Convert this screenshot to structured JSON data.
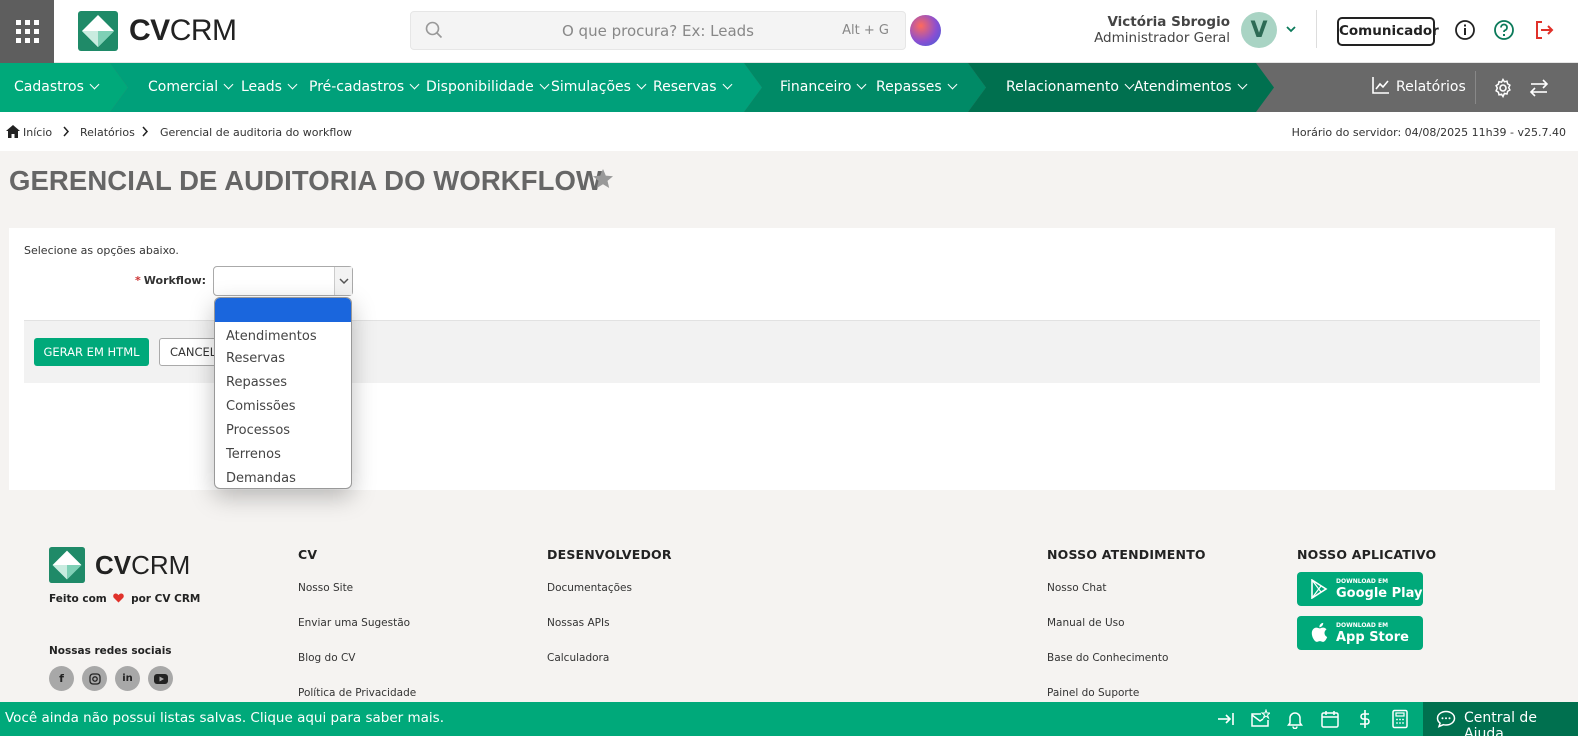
{
  "header": {
    "logo_text_bold": "CV",
    "logo_text_light": "CRM",
    "search_placeholder": "O que procura? Ex: Leads",
    "search_shortcut": "Alt + G",
    "user_name": "Victória Sbrogio",
    "user_role": "Administrador Geral",
    "avatar_letter": "V",
    "communicator_label": "Comunicador"
  },
  "nav": {
    "items": [
      {
        "label": "Cadastros"
      },
      {
        "label": "Comercial"
      },
      {
        "label": "Leads"
      },
      {
        "label": "Pré-cadastros"
      },
      {
        "label": "Disponibilidade"
      },
      {
        "label": "Simulações"
      },
      {
        "label": "Reservas"
      },
      {
        "label": "Financeiro"
      },
      {
        "label": "Repasses"
      },
      {
        "label": "Relacionamento"
      },
      {
        "label": "Atendimentos"
      }
    ],
    "reports_label": "Relatórios"
  },
  "breadcrumb": {
    "home": "Início",
    "reports": "Relatórios",
    "current": "Gerencial de auditoria do workflow",
    "server_time": "Horário do servidor: 04/08/2025 11h39 - v25.7.40"
  },
  "page": {
    "title": "GERENCIAL DE AUDITORIA DO WORKFLOW",
    "intro": "Selecione as opções abaixo.",
    "required_mark": "*",
    "workflow_label": "Workflow:",
    "generate_label": "GERAR EM HTML",
    "cancel_label": "CANCELAR"
  },
  "dropdown": {
    "options": [
      "",
      "Atendimentos",
      "Reservas",
      "Repasses",
      "Comissões",
      "Processos",
      "Terrenos",
      "Demandas"
    ],
    "highlighted_index": 0
  },
  "footer": {
    "made_with": "Feito com",
    "made_by": "por CV CRM",
    "social_title": "Nossas redes sociais",
    "columns": [
      {
        "title": "CV",
        "links": [
          "Nosso Site",
          "Enviar uma Sugestão",
          "Blog do CV",
          "Política de Privacidade"
        ]
      },
      {
        "title": "DESENVOLVEDOR",
        "links": [
          "Documentações",
          "Nossas APIs",
          "Calculadora"
        ]
      },
      {
        "title": "NOSSO ATENDIMENTO",
        "links": [
          "Nosso Chat",
          "Manual de Uso",
          "Base do Conhecimento",
          "Painel do Suporte"
        ]
      }
    ],
    "app_title": "NOSSO APLICATIVO",
    "google_small": "DOWNLOAD EM",
    "google_big": "Google Play",
    "apple_small": "DOWNLOAD EM",
    "apple_big": "App Store"
  },
  "bottom_bar": {
    "message": "Você ainda não possui listas salvas. Clique aqui para saber mais.",
    "help_label": "Central de Ajuda"
  },
  "colors": {
    "brand_green": "#00a97a",
    "dark_green": "#00704f",
    "nav_gray": "#696969",
    "selection_blue": "#1a66dd"
  }
}
